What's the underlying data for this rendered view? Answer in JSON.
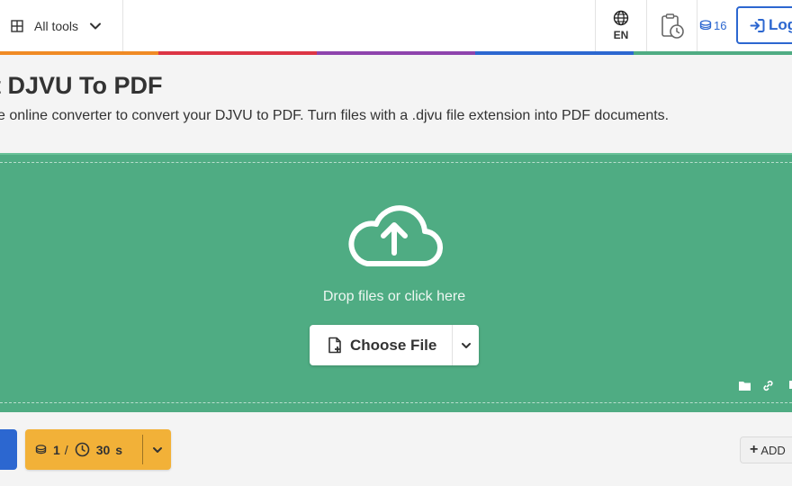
{
  "header": {
    "all_tools_label": "All tools",
    "language_code": "EN",
    "credits_count": "16",
    "login_label": "Log"
  },
  "rainbow_colors": [
    "#f08a24",
    "#f08a24",
    "#dc3545",
    "#dc3545",
    "#8e44ad",
    "#8e44ad",
    "#2c67d0",
    "#2c67d0",
    "#4fac83",
    "#4fac83"
  ],
  "page": {
    "title": "t DJVU To PDF",
    "subtitle": "e online converter to convert your DJVU to PDF. Turn files with a .djvu file extension into PDF documents."
  },
  "dropzone": {
    "drop_text": "Drop files or click here",
    "choose_label": "Choose File",
    "icons": [
      "folder-icon",
      "link-icon",
      "cloud-drive-icon"
    ]
  },
  "conversion": {
    "credit_cost": "1",
    "time_value": "30",
    "time_unit": "s"
  },
  "add_label": "ADD",
  "colors": {
    "accent_blue": "#2c67d0",
    "dropzone_green": "#4fac83",
    "orange": "#f2b138"
  }
}
